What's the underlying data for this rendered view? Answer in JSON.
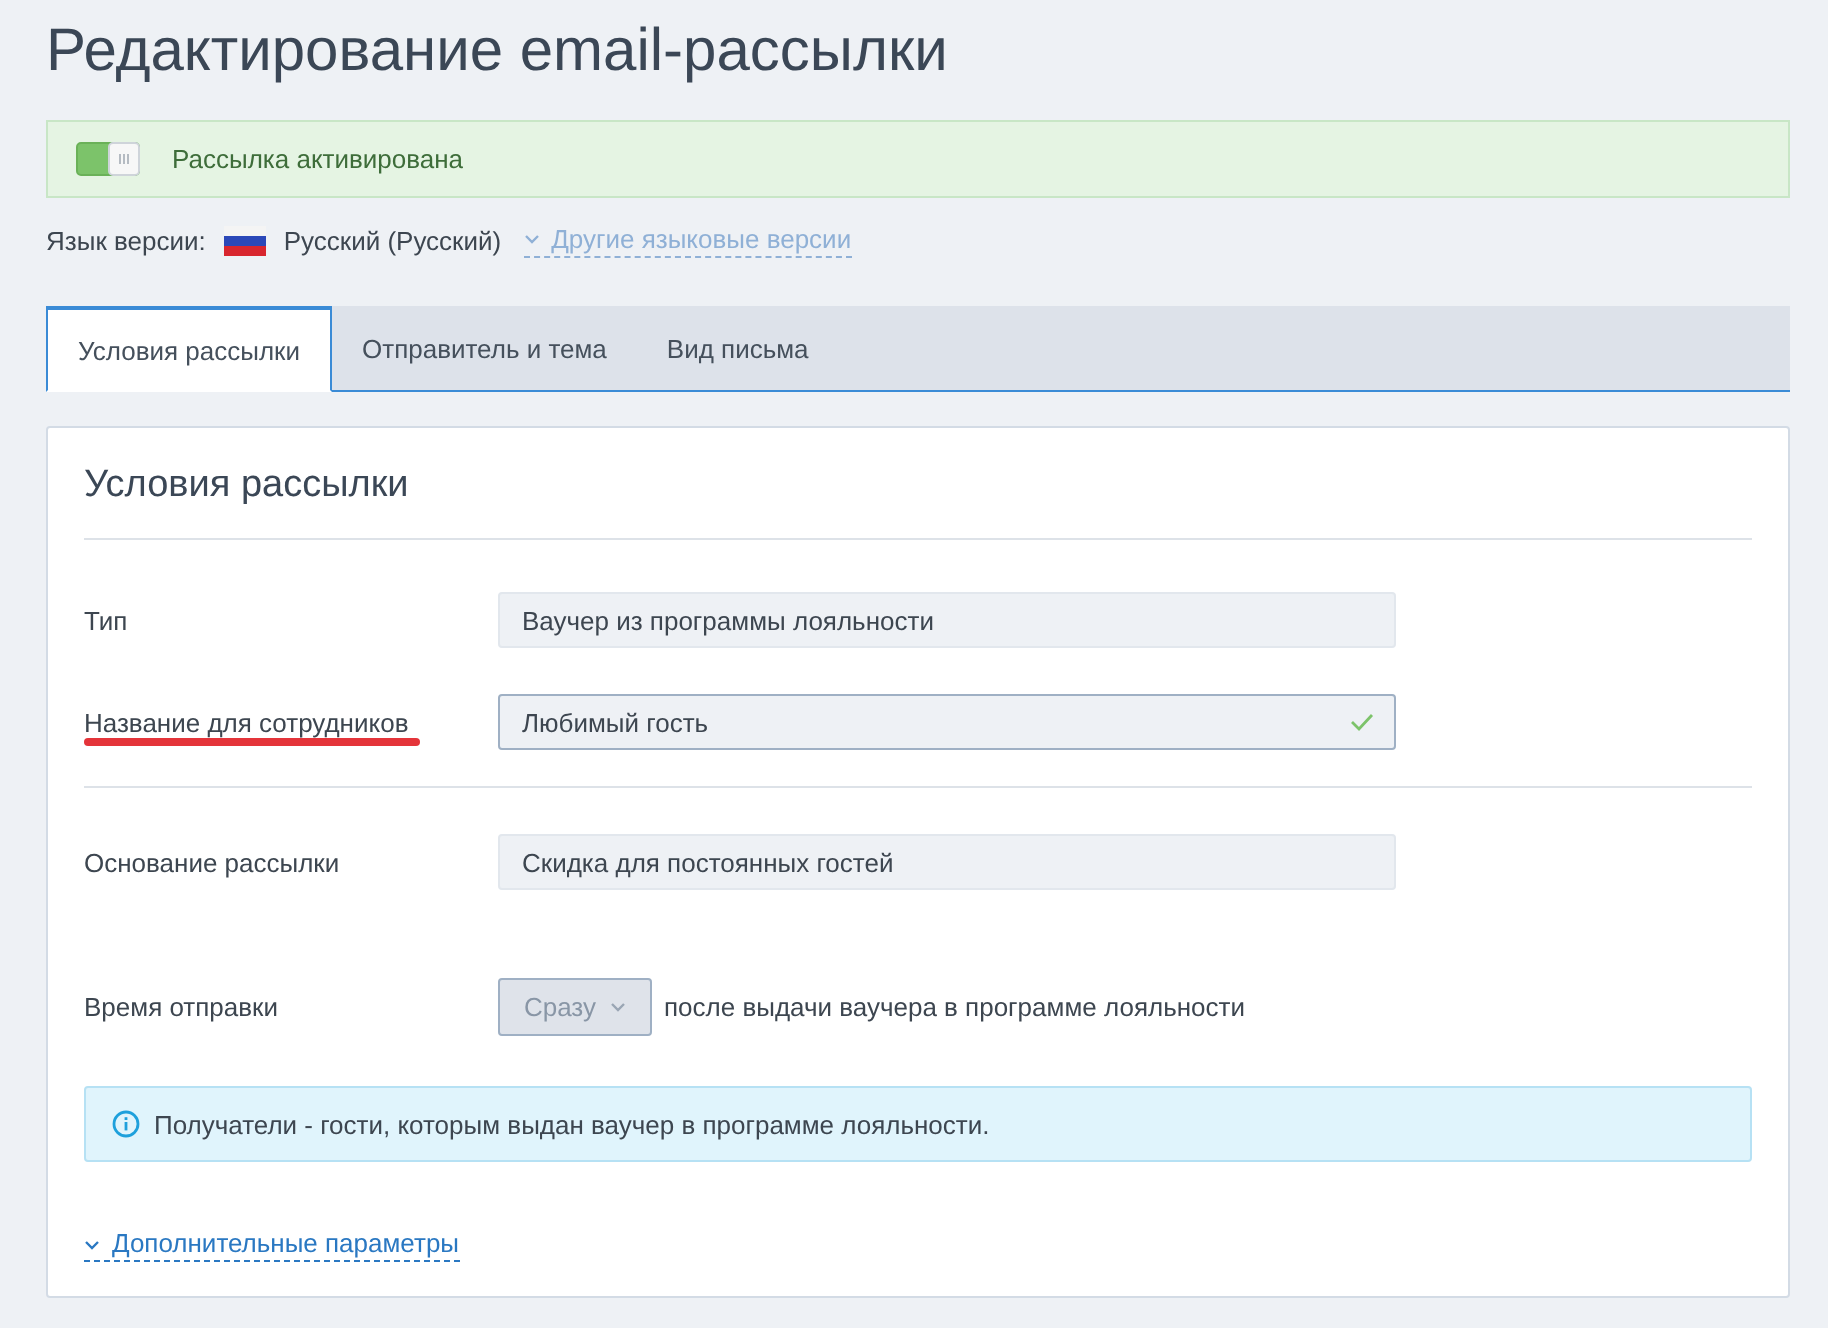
{
  "page_title": "Редактирование email-рассылки",
  "status_banner": {
    "text": "Рассылка активирована",
    "on": true
  },
  "language": {
    "label": "Язык версии:",
    "current": "Русский (Русский)",
    "other_versions_link": "Другие языковые версии"
  },
  "tabs": [
    {
      "label": "Условия рассылки",
      "selected": true
    },
    {
      "label": "Отправитель и тема",
      "selected": false
    },
    {
      "label": "Вид письма",
      "selected": false
    }
  ],
  "section": {
    "title": "Условия рассылки",
    "groups": [
      {
        "rows": [
          {
            "kind": "text",
            "label": "Тип",
            "value": "Ваучер из программы лояльности",
            "disabled": true,
            "valid": false,
            "annotated": false
          },
          {
            "kind": "text",
            "label": "Название для сотрудников",
            "value": "Любимый гость",
            "disabled": false,
            "valid": true,
            "annotated": true
          }
        ]
      },
      {
        "rows": [
          {
            "kind": "text",
            "label": "Основание рассылки",
            "value": "Скидка для постоянных гостей",
            "disabled": true,
            "valid": false,
            "annotated": false
          },
          {
            "kind": "select",
            "label": "Время отправки",
            "value": "Сразу",
            "suffix": "после выдачи ваучера в программе лояльности",
            "disabled": true,
            "valid": false,
            "annotated": false
          }
        ]
      }
    ],
    "notice": "Получатели - гости, которым выдан ваучер в программе лояльности.",
    "more_link": {
      "label": "Дополнительные параметры",
      "expanded": false
    }
  }
}
